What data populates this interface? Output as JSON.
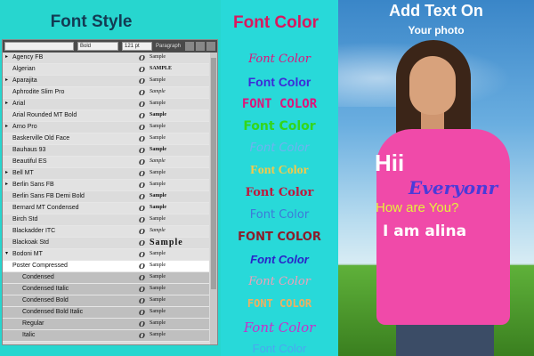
{
  "font_style_panel": {
    "title": "Font Style",
    "toolbar": {
      "search_placeholder": "",
      "weight_value": "Bold",
      "size_value": "121 pt",
      "paragraph_label": "Paragraph"
    },
    "sample_glyph": "O",
    "fonts": [
      {
        "name": "Agency FB",
        "sample": "Sample",
        "arrow": "▸",
        "style": "normal"
      },
      {
        "name": "Algerian",
        "sample": "SAMPLE",
        "arrow": "",
        "style": "caps"
      },
      {
        "name": "Aparajita",
        "sample": "Sample",
        "arrow": "▸",
        "style": "normal"
      },
      {
        "name": "Aphrodite Slim Pro",
        "sample": "Sample",
        "arrow": "",
        "style": "script"
      },
      {
        "name": "Arial",
        "sample": "Sample",
        "arrow": "▸",
        "style": "normal"
      },
      {
        "name": "Arial Rounded MT Bold",
        "sample": "Sample",
        "arrow": "",
        "style": "bold"
      },
      {
        "name": "Arno Pro",
        "sample": "Sample",
        "arrow": "▸",
        "style": "normal"
      },
      {
        "name": "Baskerville Old Face",
        "sample": "Sample",
        "arrow": "",
        "style": "normal"
      },
      {
        "name": "Bauhaus 93",
        "sample": "Sample",
        "arrow": "",
        "style": "bold"
      },
      {
        "name": "Beautiful ES",
        "sample": "Sample",
        "arrow": "",
        "style": "script"
      },
      {
        "name": "Bell MT",
        "sample": "Sample",
        "arrow": "▸",
        "style": "normal"
      },
      {
        "name": "Berlin Sans FB",
        "sample": "Sample",
        "arrow": "▸",
        "style": "normal"
      },
      {
        "name": "Berlin Sans FB Demi Bold",
        "sample": "Sample",
        "arrow": "",
        "style": "bold"
      },
      {
        "name": "Bernard MT Condensed",
        "sample": "Sample",
        "arrow": "",
        "style": "bold"
      },
      {
        "name": "Birch Std",
        "sample": "Sample",
        "arrow": "",
        "style": "normal"
      },
      {
        "name": "Blackadder ITC",
        "sample": "Sample",
        "arrow": "",
        "style": "script"
      },
      {
        "name": "Blackoak Std",
        "sample": "Sample",
        "arrow": "",
        "style": "wide"
      },
      {
        "name": "Bodoni MT",
        "sample": "Sample",
        "arrow": "▾",
        "style": "normal"
      },
      {
        "name": "Poster Compressed",
        "sample": "Sample",
        "arrow": "",
        "style": "sel"
      },
      {
        "name": "Condensed",
        "sample": "Sample",
        "arrow": "",
        "style": "sub"
      },
      {
        "name": "Condensed Italic",
        "sample": "Sample",
        "arrow": "",
        "style": "sub"
      },
      {
        "name": "Condensed Bold",
        "sample": "Sample",
        "arrow": "",
        "style": "sub"
      },
      {
        "name": "Condensed Bold Italic",
        "sample": "Sample",
        "arrow": "",
        "style": "sub"
      },
      {
        "name": "Regular",
        "sample": "Sample",
        "arrow": "",
        "style": "sub"
      },
      {
        "name": "Italic",
        "sample": "Sample",
        "arrow": "",
        "style": "sub"
      }
    ]
  },
  "font_color_panel": {
    "heading": "Font Color",
    "samples": [
      {
        "text": "Font Color",
        "color": "#e0137a"
      },
      {
        "text": "Font Color",
        "color": "#3d2bd8"
      },
      {
        "text": "FONT COLOR",
        "color": "#e0137a"
      },
      {
        "text": "Font Color",
        "color": "#33d61a"
      },
      {
        "text": "Font Color",
        "color": "#6fb3f0"
      },
      {
        "text": "Font Color",
        "color": "#f2c94c"
      },
      {
        "text": "Font Color",
        "color": "#c0163b"
      },
      {
        "text": "Font Color",
        "color": "#3d79d9"
      },
      {
        "text": "FONT COLOR",
        "color": "#8c1c2a"
      },
      {
        "text": "Font Color",
        "color": "#2a23c9"
      },
      {
        "text": "Font Color",
        "color": "#f0a0b8"
      },
      {
        "text": "FONT COLOR",
        "color": "#f0b060"
      },
      {
        "text": "Font Color",
        "color": "#c830c8"
      },
      {
        "text": "Font Color",
        "color": "#4aa8f0"
      }
    ]
  },
  "photo_panel": {
    "header": "Add Text On",
    "subheader": "Your photo",
    "overlay": {
      "hii": "Hii",
      "everyone": "Everyonr",
      "how": "How are You?",
      "name": "I am alina"
    }
  }
}
